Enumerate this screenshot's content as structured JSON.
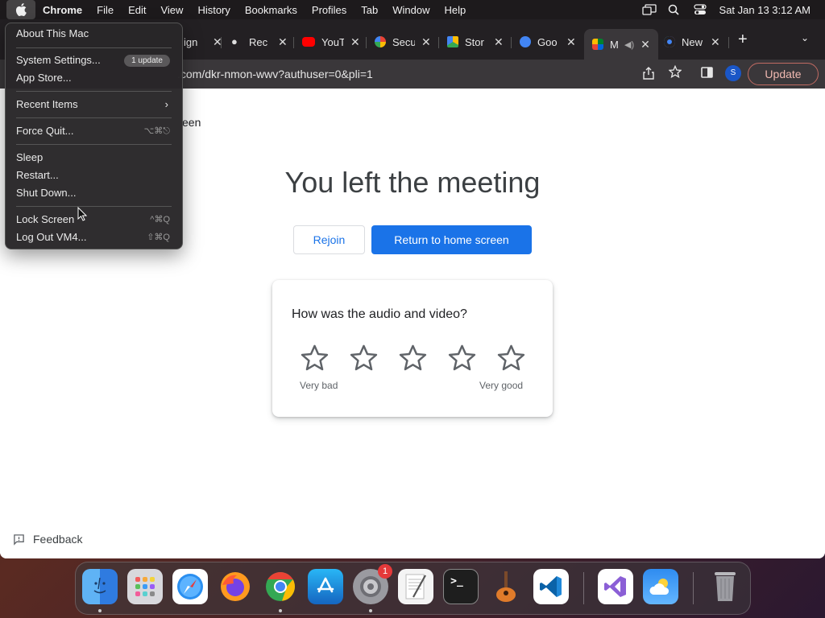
{
  "menubar": {
    "items": [
      "Chrome",
      "File",
      "Edit",
      "View",
      "History",
      "Bookmarks",
      "Profiles",
      "Tab",
      "Window",
      "Help"
    ],
    "datetime": "Sat Jan 13  3:12 AM"
  },
  "tabs": [
    {
      "title": "ign"
    },
    {
      "title": "Rec"
    },
    {
      "title": "YouT"
    },
    {
      "title": "Secu"
    },
    {
      "title": "Stor"
    },
    {
      "title": "Goo"
    },
    {
      "title": "M"
    },
    {
      "title": "New"
    }
  ],
  "toolbar": {
    "url": ".com/dkr-nmon-wwv?authuser=0&pli=1",
    "profile_initial": "S",
    "update_label": "Update"
  },
  "page": {
    "crumb": "een",
    "headline": "You left the meeting",
    "rejoin_label": "Rejoin",
    "home_label": "Return to home screen",
    "question": "How was the audio and video?",
    "very_bad": "Very bad",
    "very_good": "Very good",
    "feedback_label": "Feedback"
  },
  "apple_menu": {
    "about": "About This Mac",
    "settings": "System Settings...",
    "settings_badge": "1 update",
    "app_store": "App Store...",
    "recent": "Recent Items",
    "force_quit": "Force Quit...",
    "force_quit_sc": "⌥⌘⎋",
    "sleep": "Sleep",
    "restart": "Restart...",
    "shutdown": "Shut Down...",
    "lock": "Lock Screen",
    "lock_sc": "^⌘Q",
    "logout": "Log Out VM4...",
    "logout_sc": "⇧⌘Q"
  },
  "dock": {
    "settings_badge": "1"
  }
}
